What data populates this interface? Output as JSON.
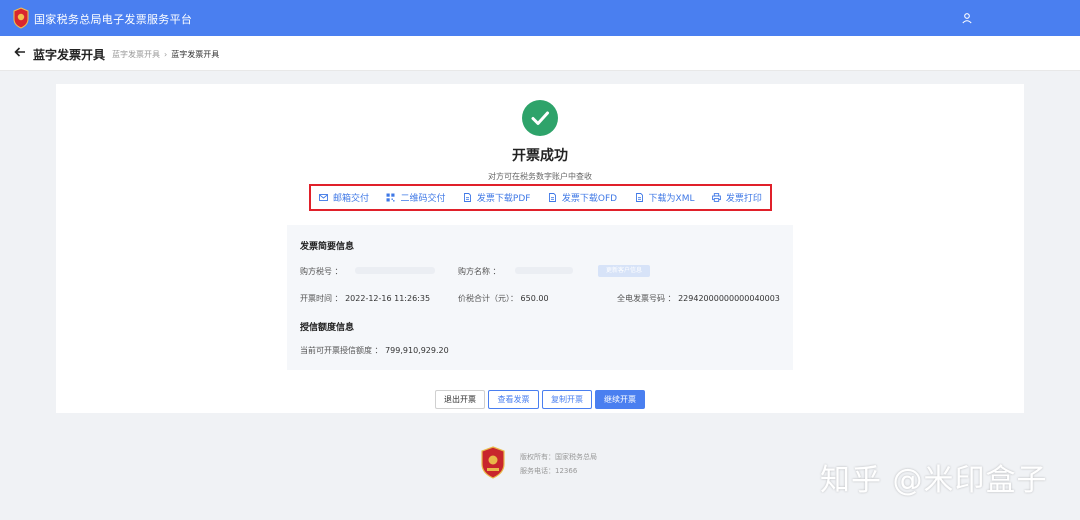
{
  "colors": {
    "brand": "#4a7ff0",
    "success": "#2ea36a",
    "highlight_border": "#e0202a",
    "link": "#3f78e6"
  },
  "header": {
    "app_title": "国家税务总局电子发票服务平台",
    "logo_icon": "tax-emblem-icon",
    "user_icon": "user-icon"
  },
  "subheader": {
    "back_icon": "arrow-left-icon",
    "page_title": "蓝字发票开具",
    "breadcrumb": [
      "蓝字发票开具",
      "蓝字发票开具"
    ],
    "separator": "›"
  },
  "result": {
    "icon": "check-circle-icon",
    "title": "开票成功",
    "subtitle": "对方可在税务数字账户中查收"
  },
  "delivery_actions": [
    {
      "label": "邮箱交付",
      "icon": "mail-icon"
    },
    {
      "label": "二维码交付",
      "icon": "qrcode-icon"
    },
    {
      "label": "发票下载PDF",
      "icon": "file-pdf-icon"
    },
    {
      "label": "发票下载OFD",
      "icon": "file-ofd-icon"
    },
    {
      "label": "下载为XML",
      "icon": "file-xml-icon"
    },
    {
      "label": "发票打印",
      "icon": "printer-icon"
    }
  ],
  "invoice_info": {
    "title": "发票简要信息",
    "buyer_tax_label": "购方税号 ：",
    "buyer_name_label": "购方名称 ：",
    "update_buyer_button": "更新客户信息",
    "issue_time_label": "开票时间 ：",
    "issue_time_value": "2022-12-16 11:26:35",
    "total_label": "价税合计（元）：",
    "total_value": "650.00",
    "invoice_no_label": "全电发票号码 ：",
    "invoice_no_value": "22942000000000040003"
  },
  "credit_info": {
    "title": "授信额度信息",
    "available_label": "当前可开票授信额度 ：",
    "available_value": "799,910,929.20"
  },
  "buttons": {
    "exit": "退出开票",
    "view": "查看发票",
    "copy": "复制开票",
    "continue": "继续开票"
  },
  "footer": {
    "emblem_icon": "tax-emblem-icon",
    "copyright": "版权所有：国家税务总局",
    "hotline": "服务电话：12366"
  },
  "watermark": "知乎 @米印盒子"
}
